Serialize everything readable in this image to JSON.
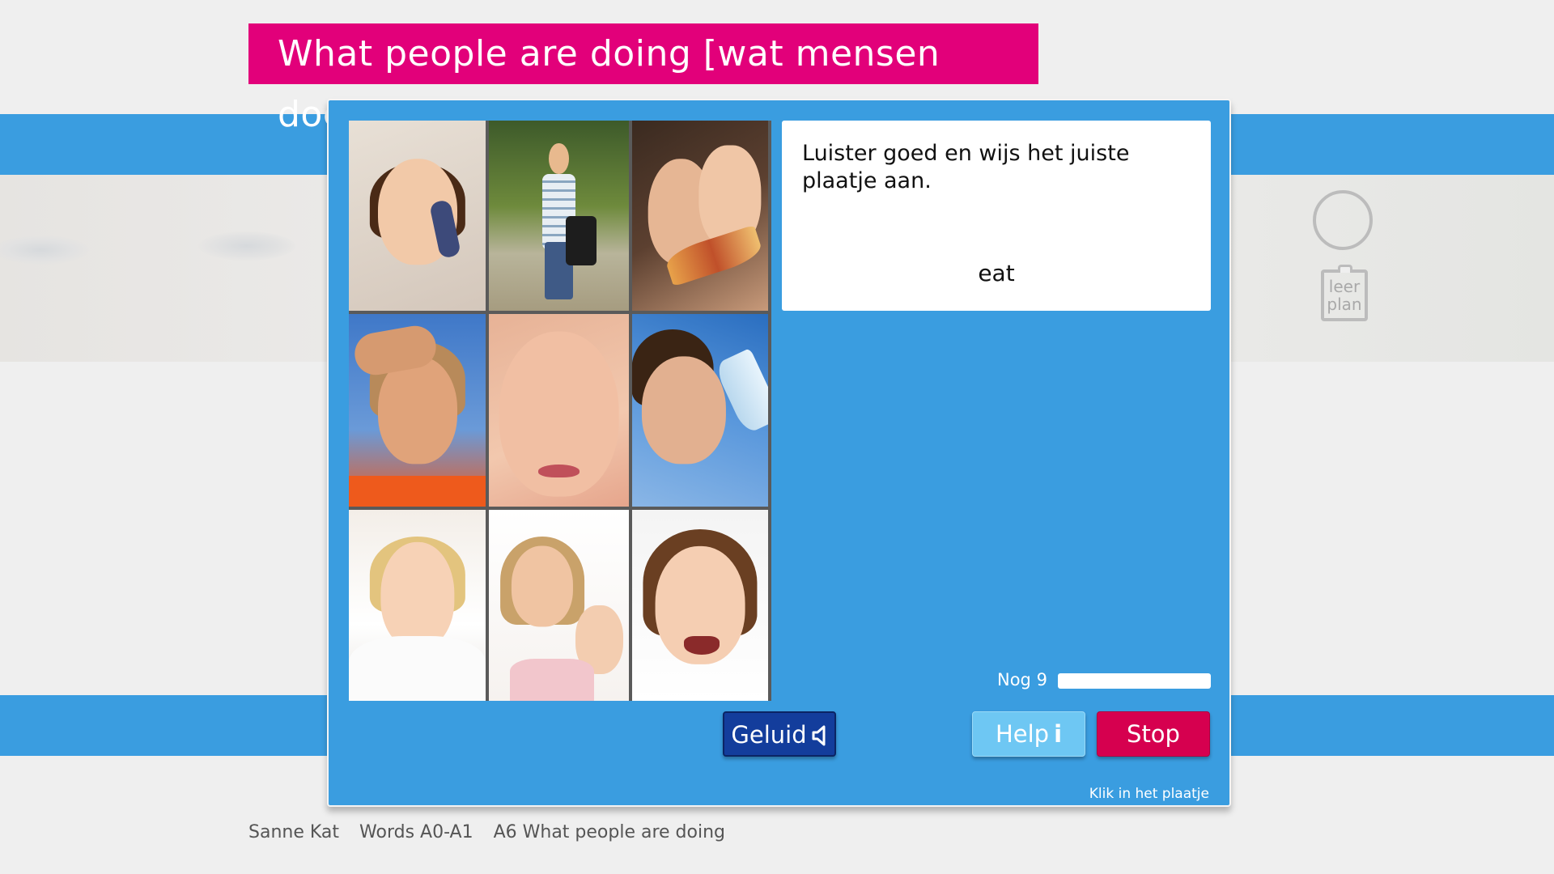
{
  "title": "What people are doing [wat mensen doen]",
  "card": {
    "instruction": "Luister goed en wijs het juiste plaatje aan.",
    "word": "eat"
  },
  "progress": {
    "label": "Nog 9",
    "remaining": 9,
    "fill_fraction": 1.0
  },
  "buttons": {
    "sound": "Geluid",
    "help": "Help",
    "help_icon": "i",
    "stop": "Stop"
  },
  "hint": "Klik in het plaatje",
  "side_icons": {
    "leerplan_line1": "leer",
    "leerplan_line2": "plan"
  },
  "footer": {
    "user": "Sanne Kat",
    "course": "Words A0-A1",
    "lesson": "A6 What people are doing"
  },
  "images": [
    {
      "icon": "girl-on-phone-photo"
    },
    {
      "icon": "boy-walking-with-bag-photo"
    },
    {
      "icon": "girls-eating-pizza-photo"
    },
    {
      "icon": "boy-looking-out-photo"
    },
    {
      "icon": "girl-crying-photo"
    },
    {
      "icon": "woman-drinking-water-photo"
    },
    {
      "icon": "girl-sleeping-photo"
    },
    {
      "icon": "girl-waving-photo"
    },
    {
      "icon": "girl-laughing-photo"
    }
  ],
  "colors": {
    "title_bg": "#e2007a",
    "panel_bg": "#3a9de0",
    "sound_btn": "#133d9c",
    "help_btn": "#6ec7f3",
    "stop_btn": "#d6004f"
  }
}
